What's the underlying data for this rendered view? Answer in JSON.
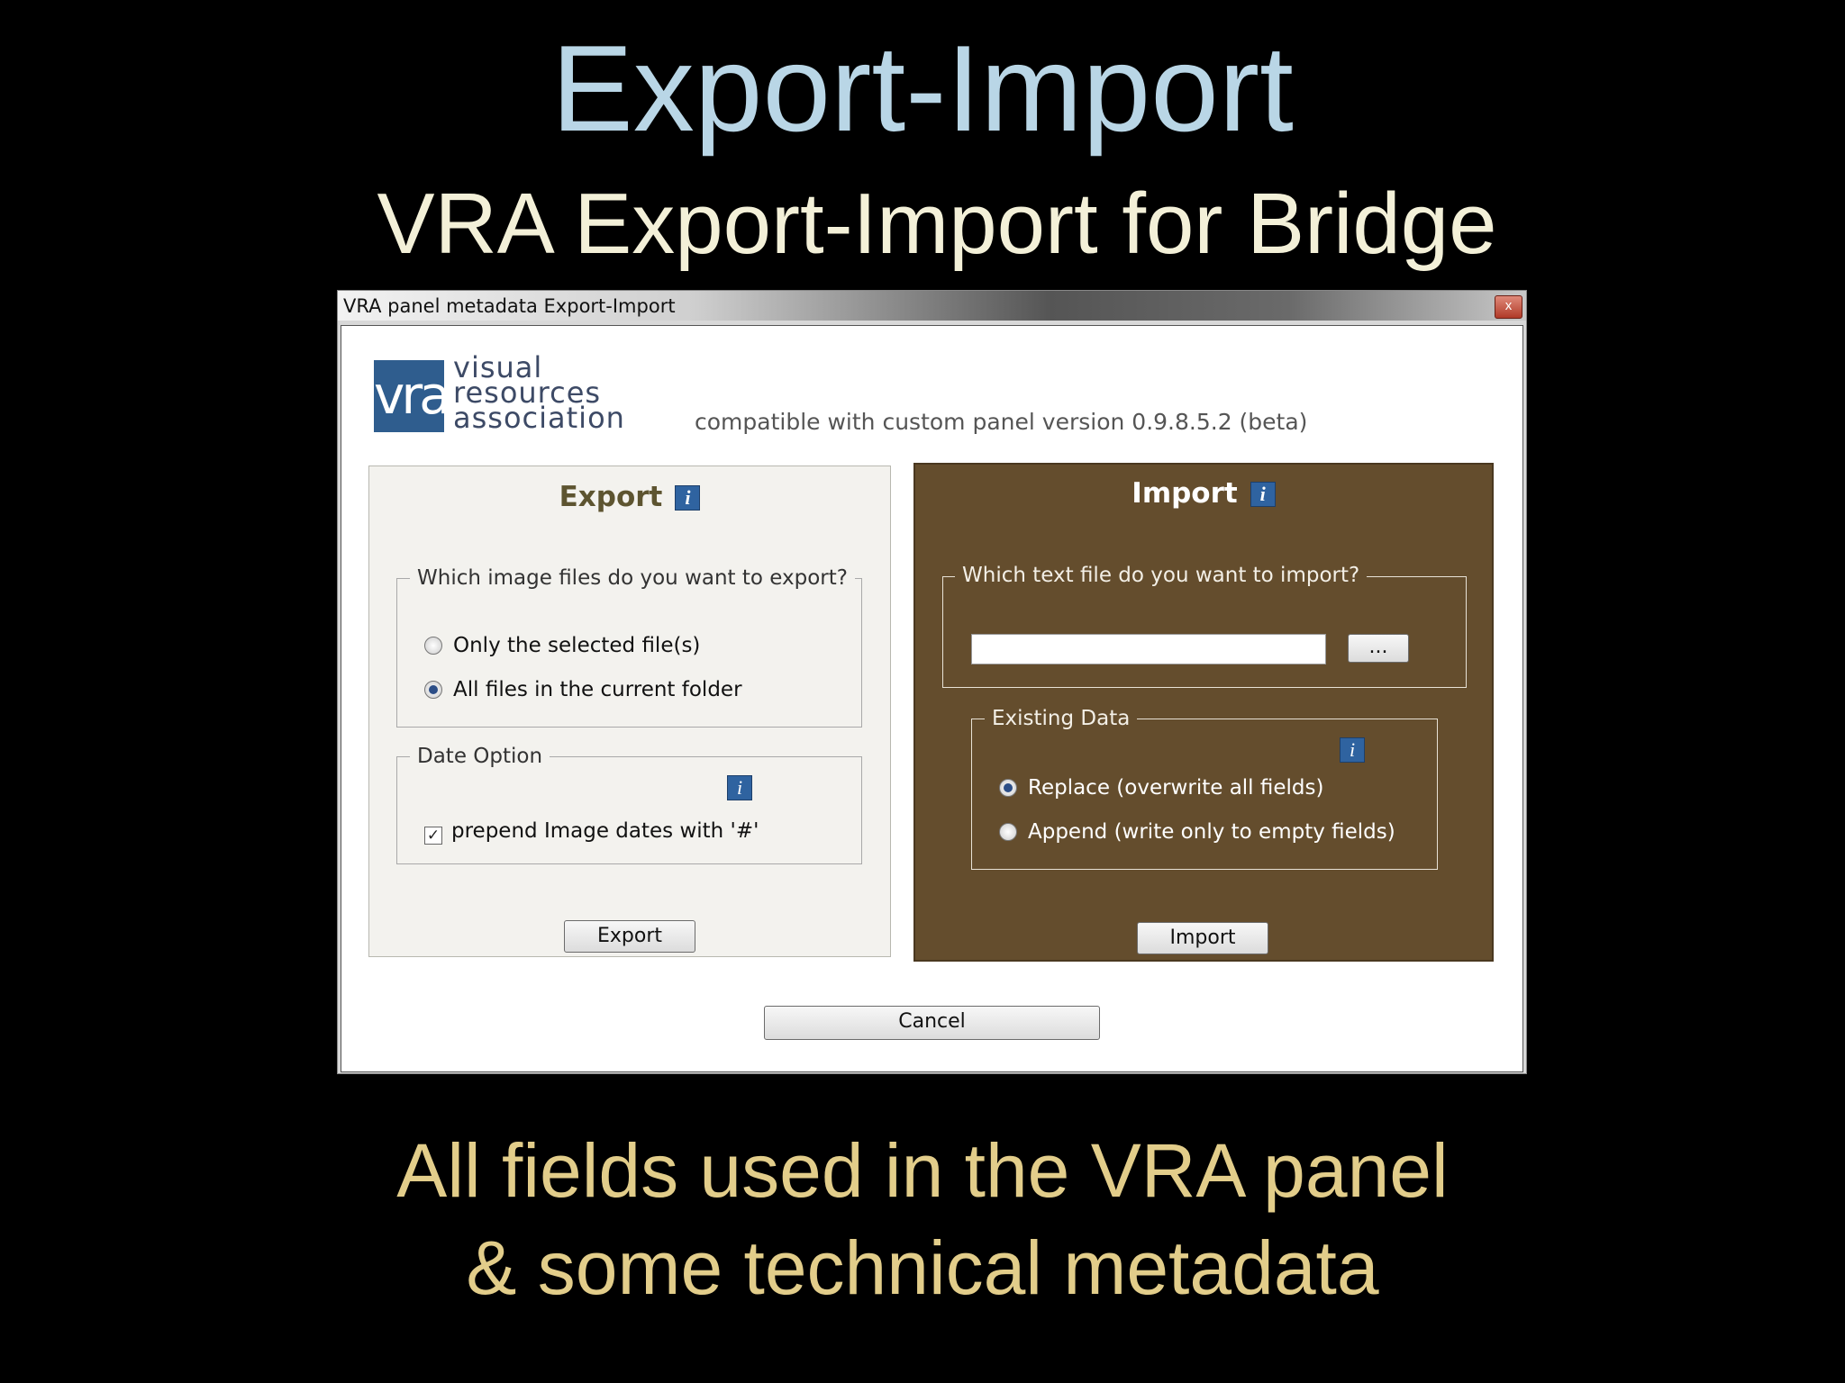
{
  "slide": {
    "title": "Export-Import",
    "subtitle": "VRA Export-Import for Bridge",
    "caption_lines": [
      "All fields used in the VRA panel",
      "& some technical metadata"
    ]
  },
  "window": {
    "title": "VRA panel metadata Export-Import",
    "close_icon_glyph": "x",
    "logo": {
      "abbr": "vra",
      "words": [
        "visual",
        "resources",
        "association"
      ],
      "color": "#2f5d8e"
    },
    "compat_text": "compatible with custom panel version 0.9.8.5.2 (beta)",
    "export_panel": {
      "title": "Export",
      "info_icon": "i",
      "files_group": {
        "legend": "Which image files do you want to export?",
        "options": [
          {
            "label": "Only the selected file(s)",
            "selected": false
          },
          {
            "label": "All files in the current folder",
            "selected": true
          }
        ]
      },
      "date_group": {
        "legend": "Date Option",
        "info_icon": "i",
        "checkbox_label": "prepend Image dates with '#'",
        "checked": true,
        "check_glyph": "✓"
      },
      "button_label": "Export"
    },
    "import_panel": {
      "title": "Import",
      "info_icon": "i",
      "file_group": {
        "legend": "Which text file do you want to import?",
        "input_value": "",
        "browse_label": "..."
      },
      "existing_group": {
        "legend": "Existing Data",
        "info_icon": "i",
        "options": [
          {
            "label": "Replace (overwrite all fields)",
            "selected": true
          },
          {
            "label": "Append (write only to empty fields)",
            "selected": false
          }
        ]
      },
      "button_label": "Import",
      "background": "#644d2d"
    },
    "cancel_label": "Cancel"
  }
}
